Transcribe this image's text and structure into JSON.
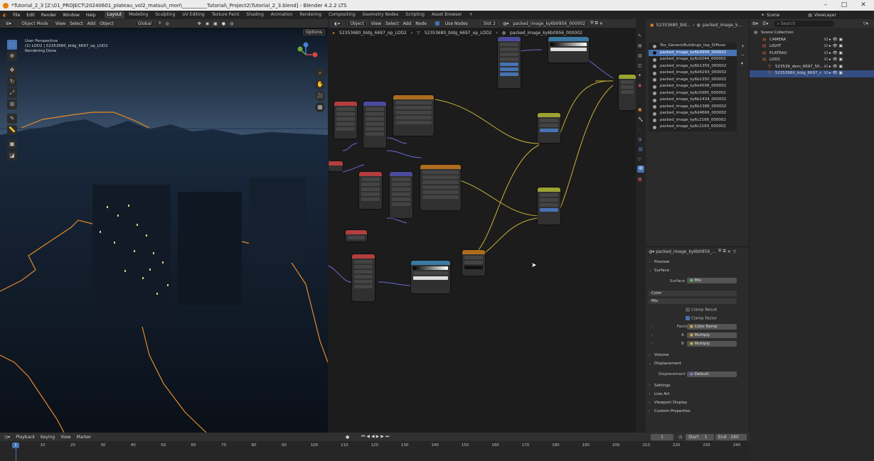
{
  "title": "*Tutorial_2_3 [Z:\\01_PROJECT\\20240601_plateau_vol2_matsui\\_mori\\__________Tutorial\\_Project2\\Tutorial_2_3.blend] - Blender 4.2.2 LTS",
  "menu": [
    "File",
    "Edit",
    "Render",
    "Window",
    "Help"
  ],
  "workspaces": [
    "Layout",
    "Modeling",
    "Sculpting",
    "UV Editing",
    "Texture Paint",
    "Shading",
    "Animation",
    "Rendering",
    "Compositing",
    "Geometry Nodes",
    "Scripting",
    "Asset Browser",
    "+"
  ],
  "active_workspace": "Layout",
  "scene": {
    "label": "Scene",
    "view_layer": "ViewLayer"
  },
  "viewport": {
    "mode": "Object Mode",
    "menus": [
      "View",
      "Select",
      "Add",
      "Object"
    ],
    "transform": "Global",
    "options": "Options",
    "overlay_line1": "User Perspective",
    "overlay_line2": "(1) LOD2 | 52353680_bldg_6697_op_LOD2",
    "overlay_line3": "Rendering Done"
  },
  "node_editor": {
    "editor_type": "Object",
    "menus": [
      "View",
      "Select",
      "Add",
      "Node"
    ],
    "use_nodes": "Use Nodes",
    "slot": "Slot 2",
    "material": "packed_image_ky6b0956_000002",
    "breadcrumb": [
      "52353680_bldg_6697_op_LOD2",
      "52353680_bldg_6697_op_LOD2",
      "packed_image_ky6b0956_000002"
    ]
  },
  "properties": {
    "breadcrumb": [
      "52353680_bld...",
      "packed_image_k..."
    ],
    "materials": [
      "Tex_GenericBuildings_top_Diffuse",
      "packed_image_ky6b0956_000002",
      "packed_image_ky6c0244_000002",
      "packed_image_ky6b1359_000002",
      "packed_image_ky6d4293_000002",
      "packed_image_ky6b1350_000002",
      "packed_image_ky6e4598_000002",
      "packed_image_ky6c0995_000002",
      "packed_image_ky6b1434_000002",
      "packed_image_ky6b1388_000002",
      "packed_image_ky6d4666_000002",
      "packed_image_ky6c2166_000002",
      "packed_image_ky6c2169_000002"
    ],
    "selected_material": "packed_image_ky6b0956_...",
    "sections": {
      "preview": "Preview",
      "surface": "Surface",
      "volume": "Volume",
      "displacement": "Displacement",
      "settings": "Settings",
      "line_art": "Line Art",
      "viewport_display": "Viewport Display",
      "custom_properties": "Custom Properties"
    },
    "surface_label": "Surface",
    "surface_value": "Mix",
    "color_value": "Color",
    "mix_value": "Mix",
    "clamp_result": "Clamp Result",
    "clamp_factor": "Clamp Factor",
    "factor_label": "Factor",
    "factor_value": "Color Ramp",
    "a_label": "A",
    "a_value": "Multiply",
    "b_label": "B",
    "b_value": "Multiply",
    "displacement_label": "Displacement",
    "displacement_value": "Default"
  },
  "outliner": {
    "search_placeholder": "Search",
    "items": [
      {
        "label": "Scene Collection",
        "color": "#cccccc"
      },
      {
        "label": "CAMERA",
        "color": "#d65a3a"
      },
      {
        "label": "LIGHT",
        "color": "#d65a3a"
      },
      {
        "label": "PLATEAU",
        "color": "#d65a3a"
      },
      {
        "label": "LOD2",
        "color": "#d65a3a"
      },
      {
        "label": "523536_dem_6697_50...",
        "color": "#e88a32"
      },
      {
        "label": "52353680_bldg_6697_c",
        "color": "#e88a32"
      }
    ]
  },
  "timeline": {
    "menus": [
      "Playback",
      "Keying",
      "View",
      "Marker"
    ],
    "current_frame": "1",
    "start_label": "Start",
    "start": "1",
    "end_label": "End",
    "end": "240",
    "ticks": [
      "1",
      "10",
      "20",
      "30",
      "40",
      "50",
      "60",
      "70",
      "80",
      "90",
      "100",
      "110",
      "120",
      "130",
      "140",
      "150",
      "160",
      "170",
      "180",
      "190",
      "200",
      "210",
      "220",
      "230",
      "240"
    ]
  },
  "colors": {
    "selection": "#4772b3",
    "accent": "#e87d0d",
    "noodle": "#c7b23a"
  }
}
